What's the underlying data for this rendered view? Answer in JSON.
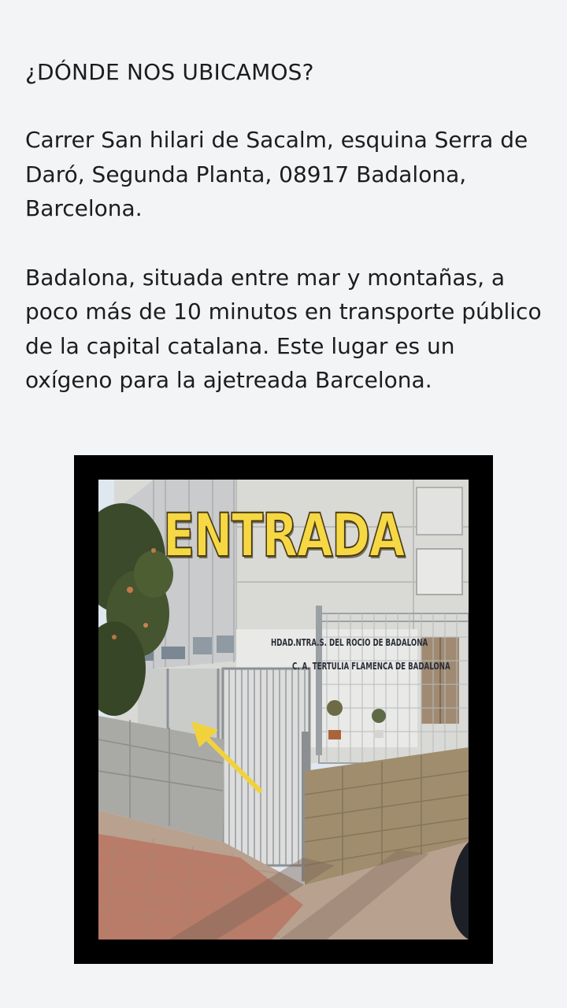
{
  "location": {
    "heading": "¿DÓNDE NOS UBICAMOS?",
    "address": "Carrer San hilari de Sacalm, esquina Serra de Daró, Segunda Planta, 08917 Badalona, Barcelona.",
    "description": "Badalona, situada entre mar y montañas, a poco más de 10 minutos en transporte público de la capital catalana. Este lugar es un oxígeno para la ajetreada Barcelona."
  },
  "photo": {
    "label": "ENTRADA",
    "sign_line_1": "HDAD.NTRA.S. DEL ROCIO DE BADALONA",
    "sign_line_2": "C. A. TERTULIA FLAMENCA DE BADALONA",
    "arrow_color": "#f2d23c",
    "label_color": "#f6d845"
  }
}
